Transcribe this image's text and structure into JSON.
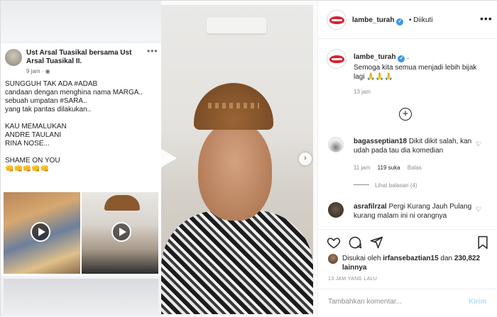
{
  "source_post": {
    "author": "Ust Arsal Tuasikal bersama Ust Arsal Tuasikal II.",
    "time": "9 jam · ",
    "more": "•••",
    "text": "SUNGGUH TAK ADA #ADAB\ncandaan dengan menghina nama MARGA..\nsebuah umpatan #SARA..\nyang tak pantas dilakukan..\n\nKAU MEMALUKAN\nANDRE TAULANI\nRINA NOSE...\n\nSHAME ON YOU\n👊👊👊👊👊"
  },
  "video": {
    "next": "›"
  },
  "header": {
    "username": "lambe_turah",
    "verified": "✓",
    "follow_status": "• Diikuti",
    "more": "•••"
  },
  "caption": {
    "username": "lambe_turah",
    "verified": "✓",
    "suffix": ".",
    "text": "Semoga kita semua menjadi lebih bijak lagi 🙏🙏🙏",
    "time": "13 jam"
  },
  "load_more": "+",
  "comments": [
    {
      "username": "bagasseptian18",
      "text": "Dikit dikit salah, kan udah pada tau dia komedian",
      "time": "11 jam",
      "likes": "119 suka",
      "reply": "Balas",
      "view_replies": "Lihat balasan (4)"
    },
    {
      "username": "asrafilrzal",
      "text": "Pergi Kurang Jauh Pulang kurang malam ini ni orangnya"
    }
  ],
  "likes": {
    "prefix": "Disukai oleh",
    "user": "irfansebaztian15",
    "middle": "dan",
    "count": "230,822 lainnya"
  },
  "post_time": "13 JAM YANG LALU",
  "comment_box": {
    "placeholder": "Tambahkan komentar...",
    "post_label": "Kirim"
  }
}
